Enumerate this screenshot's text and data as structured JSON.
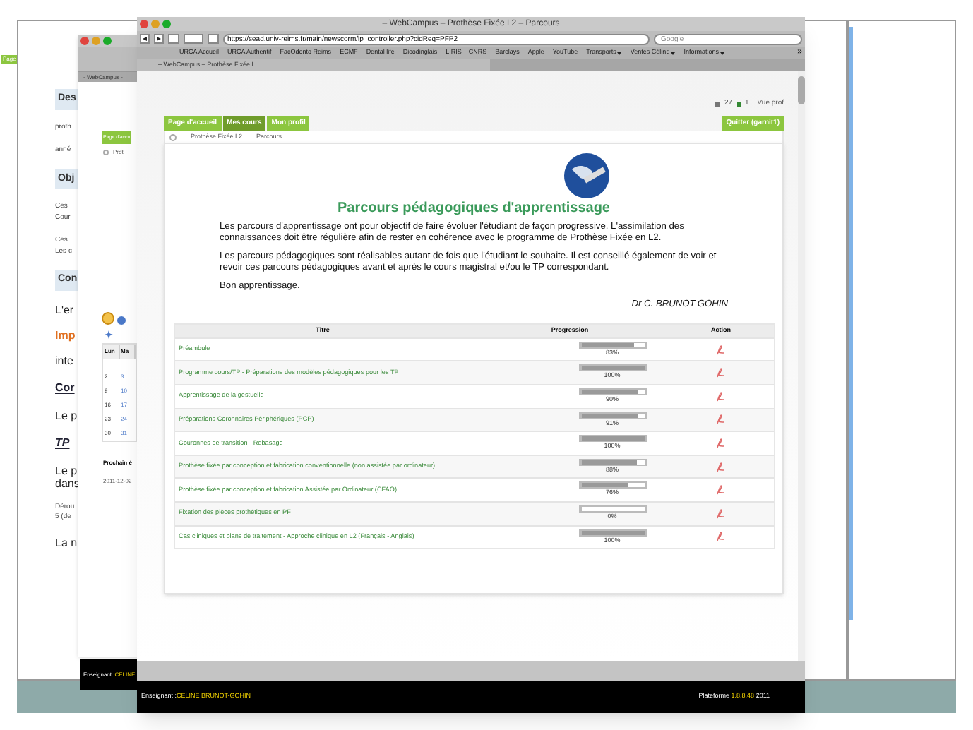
{
  "back_window": {
    "nav_tab": "Page",
    "sections": [
      {
        "kind": "heading",
        "lines": [
          "Des"
        ]
      },
      {
        "kind": "text",
        "lines": [
          "proth"
        ]
      },
      {
        "kind": "text",
        "lines": [
          "anné"
        ]
      },
      {
        "kind": "heading",
        "lines": [
          "Obj"
        ]
      },
      {
        "kind": "text",
        "lines": [
          "Ces",
          "Cour"
        ]
      },
      {
        "kind": "text",
        "lines": [
          "Ces",
          "Les c"
        ]
      },
      {
        "kind": "heading",
        "lines": [
          "Con"
        ]
      },
      {
        "kind": "large",
        "lines": [
          "L'er"
        ]
      },
      {
        "kind": "warning",
        "lines": [
          "Imp"
        ]
      },
      {
        "kind": "large",
        "lines": [
          "inte"
        ]
      },
      {
        "kind": "link",
        "lines": [
          "Cor"
        ]
      },
      {
        "kind": "large",
        "lines": [
          "Le p"
        ]
      },
      {
        "kind": "italic_link",
        "lines": [
          "TP"
        ]
      },
      {
        "kind": "large",
        "lines": [
          "Le p",
          "dans"
        ]
      },
      {
        "kind": "text",
        "lines": [
          "Dérou",
          "5 (de"
        ]
      },
      {
        "kind": "large",
        "lines": [
          "La n"
        ]
      }
    ],
    "footer": {
      "label": "Enseignant : ",
      "name": "CELINE"
    }
  },
  "middle_window": {
    "tab": "- WebCampus -",
    "nav_tab": "Page d'accu",
    "breadcrumb": "Prot",
    "calendar": {
      "columns": [
        "Lun",
        "Ma"
      ],
      "rows": [
        [
          "2",
          "3"
        ],
        [
          "9",
          "10"
        ],
        [
          "16",
          "17"
        ],
        [
          "23",
          "24"
        ],
        [
          "30",
          "31"
        ]
      ]
    },
    "next_label": "Prochain é",
    "next_date": "2011-12-02"
  },
  "window": {
    "title": "– WebCampus – Prothèse Fixée L2 – Parcours",
    "url": "https://sead.univ-reims.fr/main/newscorm/lp_controller.php?cidReq=PFP2",
    "search": {
      "placeholder": "Google"
    },
    "bookmarks": [
      {
        "label": "URCA Accueil",
        "menu": false
      },
      {
        "label": "URCA Authentif",
        "menu": false
      },
      {
        "label": "FacOdonto Reims",
        "menu": false
      },
      {
        "label": "ECMF",
        "menu": false
      },
      {
        "label": "Dental life",
        "menu": false
      },
      {
        "label": "Dicodinglais",
        "menu": false
      },
      {
        "label": "LIRIS – CNRS",
        "menu": false
      },
      {
        "label": "Barclays",
        "menu": false
      },
      {
        "label": "Apple",
        "menu": false
      },
      {
        "label": "YouTube",
        "menu": false
      },
      {
        "label": "Transports",
        "menu": true
      },
      {
        "label": "Ventes Céline",
        "menu": true
      },
      {
        "label": "Informations",
        "menu": true
      }
    ],
    "more": "»",
    "tab": "– WebCampus – Prothèse Fixée L..."
  },
  "header": {
    "users": "27",
    "messages": "1",
    "view": "Vue prof"
  },
  "nav": [
    {
      "label": "Page d'accueil",
      "selected": false
    },
    {
      "label": "Mes cours",
      "selected": true
    },
    {
      "label": "Mon profil",
      "selected": false
    }
  ],
  "quit": "Quitter (garnit1)",
  "breadcrumb": [
    "Prothèse Fixée L2",
    "Parcours"
  ],
  "intro": {
    "title": "Parcours pédagogiques d'apprentissage",
    "paragraphs": [
      "Les parcours d'apprentissage ont pour objectif de faire évoluer l'étudiant de façon progressive. L'assimilation des connaissances doit être régulière afin de rester en cohérence avec le programme de Prothèse Fixée en L2.",
      "Les parcours pédagogiques sont réalisables autant de fois que l'étudiant le souhaite. Il est conseillé également de voir et revoir ces parcours pédagogiques avant et après le cours magistral et/ou le TP correspondant.",
      "Bon apprentissage."
    ],
    "signature": "Dr C. BRUNOT-GOHIN"
  },
  "table": {
    "columns": [
      "Titre",
      "Progression",
      "Action"
    ],
    "rows": [
      {
        "title": "Préambule",
        "level": 0.83,
        "reading": "83%"
      },
      {
        "title": "Programme cours/TP - Préparations des modèles pédagogiques pour les TP",
        "level": 1,
        "reading": "100%"
      },
      {
        "title": "Apprentissage de la gestuelle",
        "level": 0.9,
        "reading": "90%"
      },
      {
        "title": "Préparations Coronnaires Périphériques (PCP)",
        "level": 0.91,
        "reading": "91%"
      },
      {
        "title": "Couronnes de transition - Rebasage",
        "level": 1,
        "reading": "100%"
      },
      {
        "title": "Prothèse fixée par conception et fabrication conventionnelle (non assistée par ordinateur)",
        "level": 0.88,
        "reading": "88%"
      },
      {
        "title": "Prothèse fixée par conception et fabrication Assistée par Ordinateur (CFAO)",
        "level": 0.76,
        "reading": "76%"
      },
      {
        "title": "Fixation des pièces prothétiques en PF",
        "level": 0,
        "reading": "0%"
      },
      {
        "title": "Cas cliniques et plans de traitement - Approche clinique en L2 (Français - Anglais)",
        "level": 1,
        "reading": "100%"
      }
    ]
  },
  "footer": {
    "label": "Enseignant : ",
    "name": "CELINE BRUNOT-GOHIN",
    "platform": "Plateforme ",
    "version": "1.8.8.48",
    "year": " 2011"
  }
}
